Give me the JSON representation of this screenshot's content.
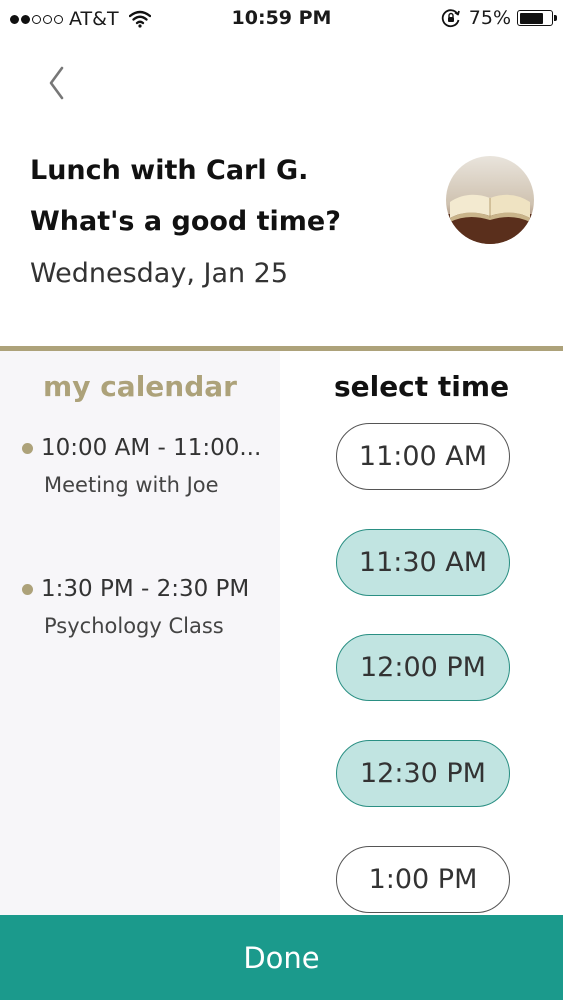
{
  "status_bar": {
    "carrier": "AT&T",
    "time": "10:59 PM",
    "battery": "75%",
    "battery_level": 0.75,
    "signal_bars_filled": 2,
    "signal_bars_total": 5
  },
  "header": {
    "title_line1": "Lunch with Carl G.",
    "title_line2": "What's a good time?",
    "date": "Wednesday, Jan 25"
  },
  "calendar": {
    "heading": "my calendar",
    "events": [
      {
        "time": "10:00 AM - 11:00...",
        "title": "Meeting with Joe"
      },
      {
        "time": "1:30 PM - 2:30 PM",
        "title": "Psychology Class"
      }
    ]
  },
  "times": {
    "heading": "select time",
    "slots": [
      {
        "label": "11:00 AM",
        "selected": false
      },
      {
        "label": "11:30 AM",
        "selected": true
      },
      {
        "label": "12:00 PM",
        "selected": true
      },
      {
        "label": "12:30 PM",
        "selected": true
      },
      {
        "label": "1:00 PM",
        "selected": false
      }
    ]
  },
  "footer": {
    "done_label": "Done"
  },
  "colors": {
    "accent_gold": "#ada27a",
    "done_teal": "#1b9a8c",
    "selected_fill": "#c1e4e1",
    "calendar_bg": "#f7f6f9"
  },
  "icons": {
    "back": "chevron-left-icon",
    "wifi": "wifi-icon",
    "rotation_lock": "rotation-lock-icon",
    "battery": "battery-icon",
    "avatar": "open-book-photo"
  }
}
